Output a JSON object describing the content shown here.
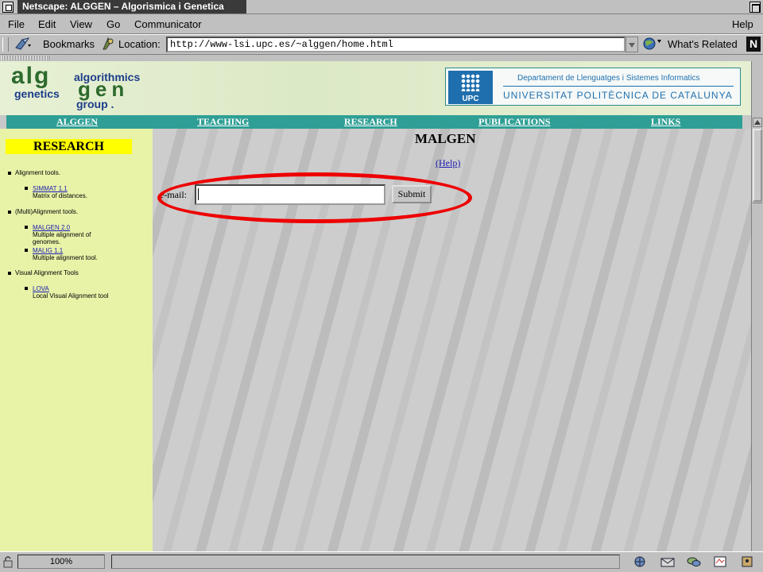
{
  "window": {
    "title": "Netscape: ALGGEN – Algorismica i Genetica"
  },
  "menu": {
    "items": [
      "File",
      "Edit",
      "View",
      "Go",
      "Communicator"
    ],
    "help": "Help"
  },
  "toolbar": {
    "bookmarks_label": "Bookmarks",
    "location_label": "Location:",
    "url": "http://www-lsi.upc.es/~alggen/home.html",
    "related_label": "What's Related",
    "brand_letter": "N"
  },
  "banner": {
    "logo_words": {
      "alg": "alg",
      "gen": "gen",
      "algorithmics": "algorithmics",
      "genetics": "genetics",
      "group": "group ."
    },
    "upc_mark": "UPC",
    "department": "Departament de Llenguatges i Sistemes Informatics",
    "university": "UNIVERSITAT POLITÈCNICA DE CATALUNYA"
  },
  "nav": [
    "ALGGEN",
    "TEACHING",
    "RESEARCH",
    "PUBLICATIONS",
    "LINKS"
  ],
  "sidebar": {
    "heading": "RESEARCH",
    "categories": [
      {
        "label": "Alignment tools.",
        "tools": [
          {
            "link": "SIMMAT 1.1",
            "desc": [
              "Matrix of distances."
            ]
          }
        ]
      },
      {
        "label": "(Multi)Alignment tools.",
        "tools": [
          {
            "link": "MALGEN 2.0",
            "desc": [
              "Multiple alignment of",
              "genomes."
            ]
          },
          {
            "link": "MALIG 1.1",
            "desc": [
              "Multiple alignment tool."
            ]
          }
        ]
      },
      {
        "label": "Visual Alignment Tools",
        "tools": [
          {
            "link": "LOVA",
            "desc": [
              "Local Visual Alignment tool"
            ]
          }
        ]
      }
    ]
  },
  "main": {
    "title": "MALGEN",
    "help_link": "(Help)",
    "email_label": "e-mail:",
    "email_value": "",
    "submit_label": "Submit"
  },
  "status": {
    "zoom": "100%",
    "message": ""
  },
  "colors": {
    "nav_bar": "#2f9f95",
    "sidebar": "#e8f3a8",
    "heading_highlight": "#ffff00",
    "annotation_ellipse": "#ee0000",
    "upc_blue": "#1f6fae"
  }
}
